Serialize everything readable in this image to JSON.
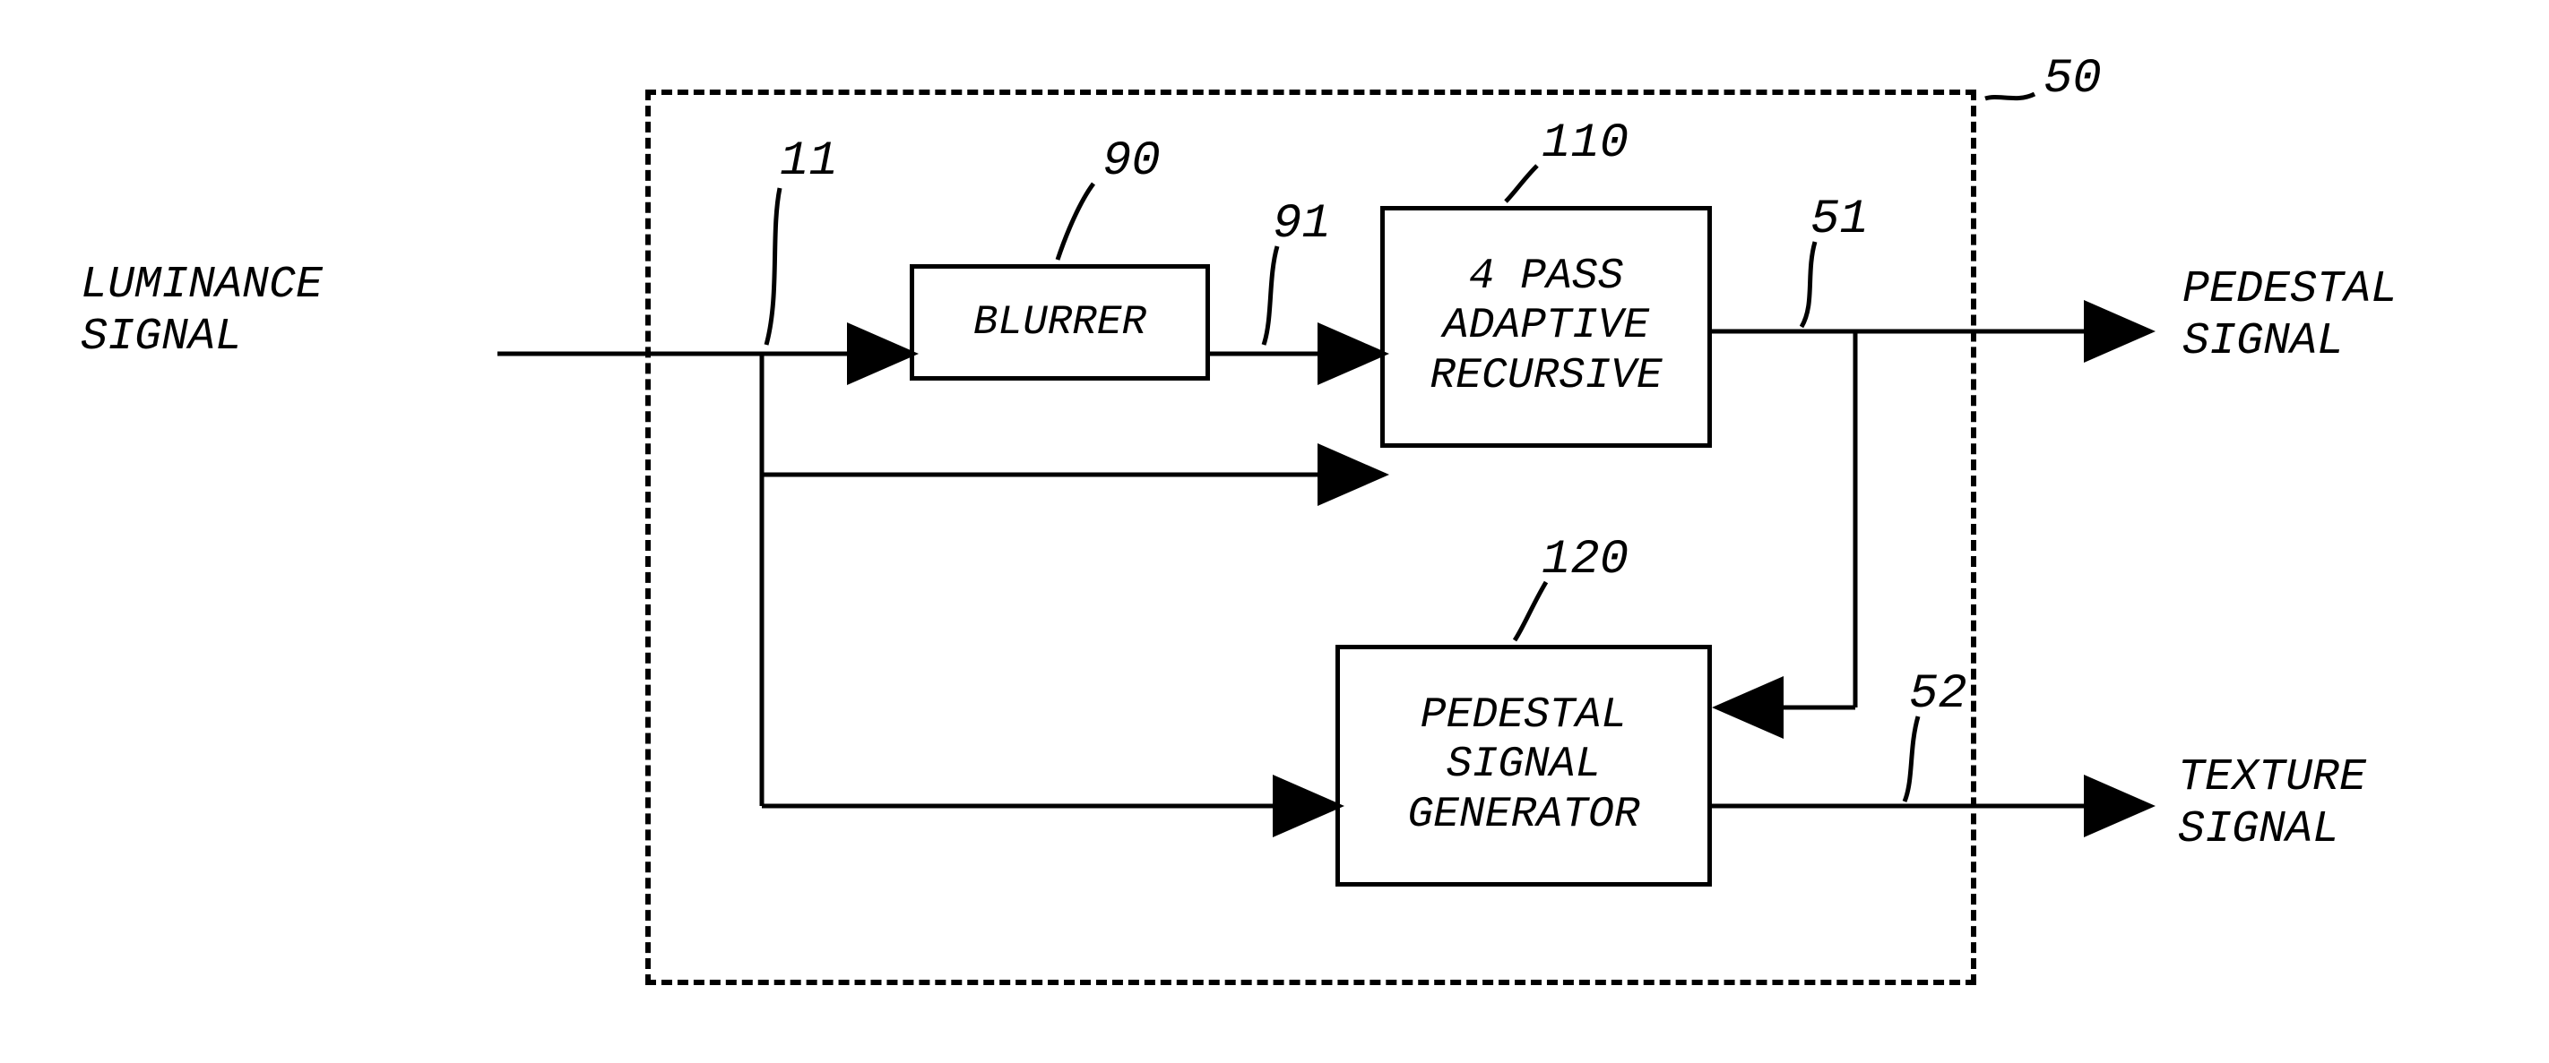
{
  "inputs": {
    "luminance": "LUMINANCE\nSIGNAL"
  },
  "outputs": {
    "pedestal": "PEDESTAL\nSIGNAL",
    "texture": "TEXTURE\nSIGNAL"
  },
  "blocks": {
    "blurrer": "BLURRER",
    "adaptive": "4 PASS\nADAPTIVE\nRECURSIVE",
    "pedgen": "PEDESTAL\nSIGNAL\nGENERATOR"
  },
  "refs": {
    "module": "50",
    "luminanceWire": "11",
    "blurrer": "90",
    "blurOut": "91",
    "adaptive": "110",
    "pedgen": "120",
    "pedestalOut": "51",
    "textureOut": "52"
  }
}
